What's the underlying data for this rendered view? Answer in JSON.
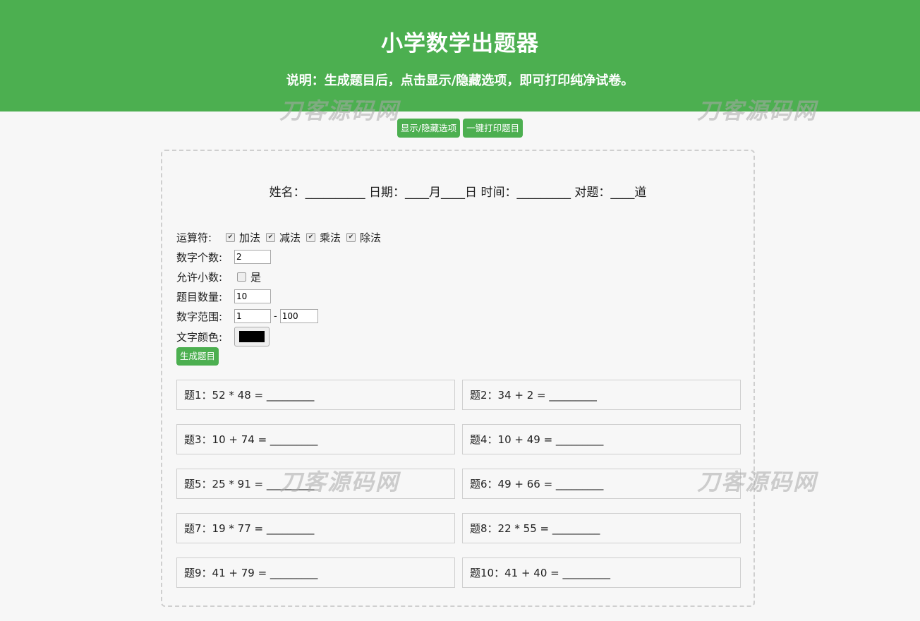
{
  "header": {
    "title": "小学数学出题器",
    "description": "说明：生成题目后，点击显示/隐藏选项，即可打印纯净试卷。"
  },
  "watermark": "刀客源码网",
  "actions": {
    "toggle_label": "显示/隐藏选项",
    "print_label": "一键打印题目"
  },
  "student_line": "姓名：__________ 日期：____月____日 时间：_________ 对题：____道",
  "options": {
    "operators_label": "运算符:",
    "operators": [
      {
        "label": "加法",
        "checked": true
      },
      {
        "label": "减法",
        "checked": true
      },
      {
        "label": "乘法",
        "checked": true
      },
      {
        "label": "除法",
        "checked": true
      }
    ],
    "num_count_label": "数字个数:",
    "num_count_value": "2",
    "decimal_label": "允许小数:",
    "decimal_option": "是",
    "decimal_checked": false,
    "question_count_label": "题目数量:",
    "question_count_value": "10",
    "range_label": "数字范围:",
    "range_min": "1",
    "range_sep": "-",
    "range_max": "100",
    "color_label": "文字颜色:",
    "color_value": "#000000",
    "generate_label": "生成题目"
  },
  "problems": [
    "题1：52 * 48 = _________",
    "题2：34 + 2 = _________",
    "题3：10 + 74 = _________",
    "题4：10 + 49 = _________",
    "题5：25 * 91 = _________",
    "题6：49 + 66 = _________",
    "题7：19 * 77 = _________",
    "题8：22 * 55 = _________",
    "题9：41 + 79 = _________",
    "题10：41 + 40 = _________"
  ],
  "colors": {
    "accent": "#4caf50",
    "background": "#f7f7f7"
  }
}
